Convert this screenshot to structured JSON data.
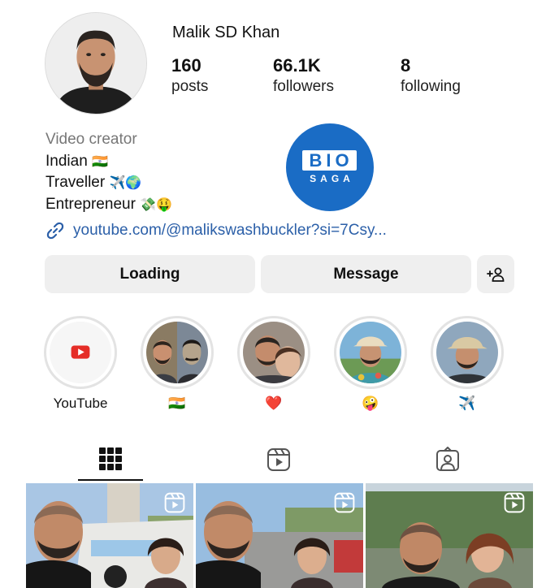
{
  "profile": {
    "username": "Malik SD Khan",
    "posts_count": "160",
    "posts_label": "posts",
    "followers_count": "66.1K",
    "followers_label": "followers",
    "following_count": "8",
    "following_label": "following"
  },
  "bio": {
    "category": "Video creator",
    "line1": "Indian",
    "line1_emoji": "🇮🇳",
    "line2": "Traveller",
    "line2_emoji": "✈️🌍",
    "line3": "Entrepreneur",
    "line3_emoji": "💸🤑",
    "link": "youtube.com/@malikswashbuckler?si=7Csy..."
  },
  "badge": {
    "line1": "BIO",
    "line2": "SAGA",
    "color": "#1a6cc5"
  },
  "buttons": {
    "follow_label": "Loading",
    "message_label": "Message",
    "add_user_icon": "add-user-icon"
  },
  "highlights": [
    {
      "caption": "YouTube",
      "icon": "youtube-icon"
    },
    {
      "caption": "🇮🇳"
    },
    {
      "caption": "❤️"
    },
    {
      "caption": "🤪"
    },
    {
      "caption": "✈️"
    }
  ],
  "tabs": {
    "active": "grid",
    "items": [
      "grid-icon",
      "reels-icon",
      "tagged-icon"
    ]
  },
  "posts": [
    {
      "type": "reel"
    },
    {
      "type": "reel"
    },
    {
      "type": "reel"
    }
  ],
  "colors": {
    "link": "#2b5fa8",
    "button_bg": "#efefef",
    "youtube_red": "#e52d27"
  }
}
